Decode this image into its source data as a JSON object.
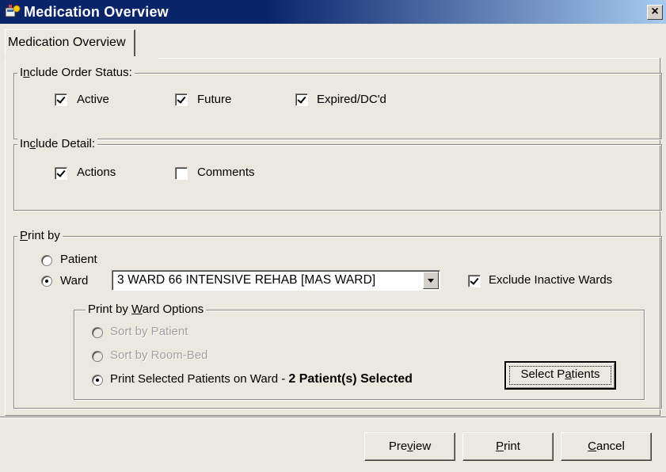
{
  "window": {
    "title": "Medication Overview",
    "close_glyph": "×"
  },
  "tabs": [
    {
      "label": "Medication Overview"
    }
  ],
  "order_status": {
    "legend_pre": "I",
    "legend_u": "n",
    "legend_post": "clude Order Status:",
    "items": [
      {
        "label": "Active",
        "checked": true
      },
      {
        "label": "Future",
        "checked": true
      },
      {
        "label": "Expired/DC'd",
        "checked": true
      }
    ]
  },
  "detail": {
    "legend_pre": "In",
    "legend_u": "c",
    "legend_post": "lude Detail:",
    "items": [
      {
        "label": "Actions",
        "checked": true
      },
      {
        "label": "Comments",
        "checked": false
      }
    ]
  },
  "print_by": {
    "legend_pre": "",
    "legend_u": "P",
    "legend_post": "rint by",
    "patient_label": "Patient",
    "patient_selected": false,
    "ward_label": "Ward",
    "ward_selected": true,
    "ward_value": "3 WARD 66 INTENSIVE REHAB [MAS WARD]",
    "exclude_inactive_label": "Exclude Inactive Wards",
    "exclude_inactive_checked": true,
    "ward_options": {
      "legend_pre": "Print by ",
      "legend_u": "W",
      "legend_post": "ard Options",
      "sort_patient": "Sort by Patient",
      "sort_roombed": "Sort by Room-Bed",
      "print_selected": "Print Selected Patients on Ward - ",
      "selected_count": "2 Patient(s) Selected",
      "select_btn_pre": "Select P",
      "select_btn_u": "a",
      "select_btn_post": "tients"
    }
  },
  "footer": {
    "preview_pre": "Pre",
    "preview_u": "v",
    "preview_post": "iew",
    "print_pre": "",
    "print_u": "P",
    "print_post": "rint",
    "cancel_pre": "",
    "cancel_u": "C",
    "cancel_post": "ancel"
  },
  "colors": {
    "titlebar": "#0a246a",
    "face": "#ebe8e0"
  }
}
